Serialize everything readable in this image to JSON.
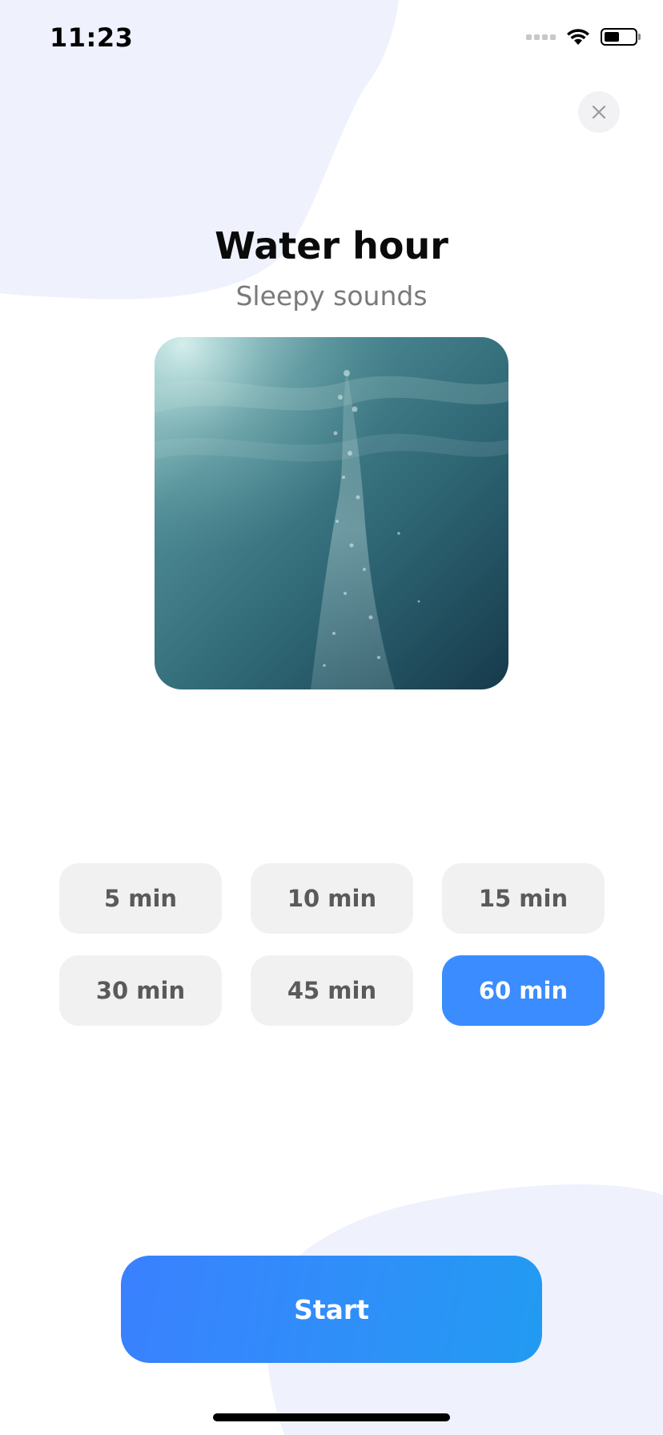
{
  "status_bar": {
    "time": "11:23",
    "icons": [
      "signal-icon",
      "wifi-icon",
      "battery-icon"
    ]
  },
  "header": {
    "close_icon": "close-icon"
  },
  "sound": {
    "title": "Water hour",
    "subtitle": "Sleepy sounds",
    "artwork_description": "underwater-bubbles"
  },
  "durations": [
    {
      "label": "5 min",
      "selected": false
    },
    {
      "label": "10 min",
      "selected": false
    },
    {
      "label": "15 min",
      "selected": false
    },
    {
      "label": "30 min",
      "selected": false
    },
    {
      "label": "45 min",
      "selected": false
    },
    {
      "label": "60 min",
      "selected": true
    }
  ],
  "actions": {
    "start_label": "Start"
  },
  "colors": {
    "accent": "#3a8cff",
    "chip_bg": "#f1f1f1",
    "chip_text": "#5a5a5a",
    "blob": "#eff2fc"
  }
}
